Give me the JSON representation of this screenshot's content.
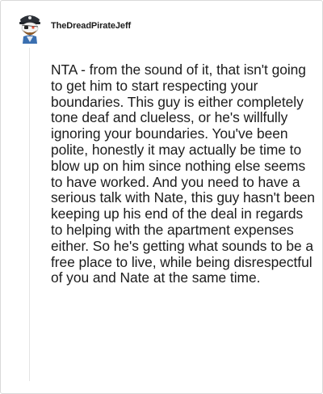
{
  "comment": {
    "username": "TheDreadPirateJeff",
    "avatar": "pirate-snoo-avatar-icon",
    "body": "NTA - from the sound of it, that isn't going to get him to start respecting your boundaries. This guy is either completely tone deaf and clueless, or he's willfully ignoring your boundaries. You've been polite, honestly it may actually be time to blow up on him since nothing else seems to have worked. And you need to have a serious talk with Nate, this guy hasn't been keeping up his end of the deal in regards to helping with the apartment expenses either. So he's getting what sounds to be a free place to live, while being disrespectful of you and Nate at the same time."
  },
  "colors": {
    "text": "#1c1c1c",
    "border": "#d9d9d9",
    "thread_line": "#e4e4e4",
    "avatar_hat": "#2b2f36",
    "avatar_beard": "#8a5a2b"
  }
}
